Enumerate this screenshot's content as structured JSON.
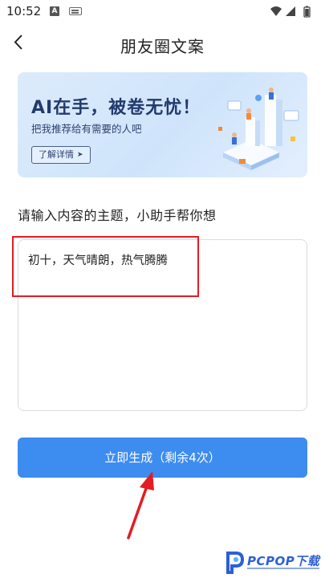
{
  "status_bar": {
    "time": "10:52",
    "a_badge": "A"
  },
  "header": {
    "title": "朋友圈文案"
  },
  "banner": {
    "headline": "AI在手，被卷无忧！",
    "subtitle": "把我推荐给有需要的人吧",
    "button_label": "了解详情",
    "button_arrow": "➤"
  },
  "prompt": {
    "label": "请输入内容的主题，小助手帮你想",
    "input_value": "初十，天气晴朗，热气腾腾"
  },
  "generate": {
    "label": "立即生成（剩余4次）"
  },
  "watermark": {
    "text": "PCPOP下载"
  },
  "colors": {
    "primary_button": "#3d8cf0",
    "annotation_red": "#e41c24",
    "banner_bg": "#dcebfb"
  }
}
